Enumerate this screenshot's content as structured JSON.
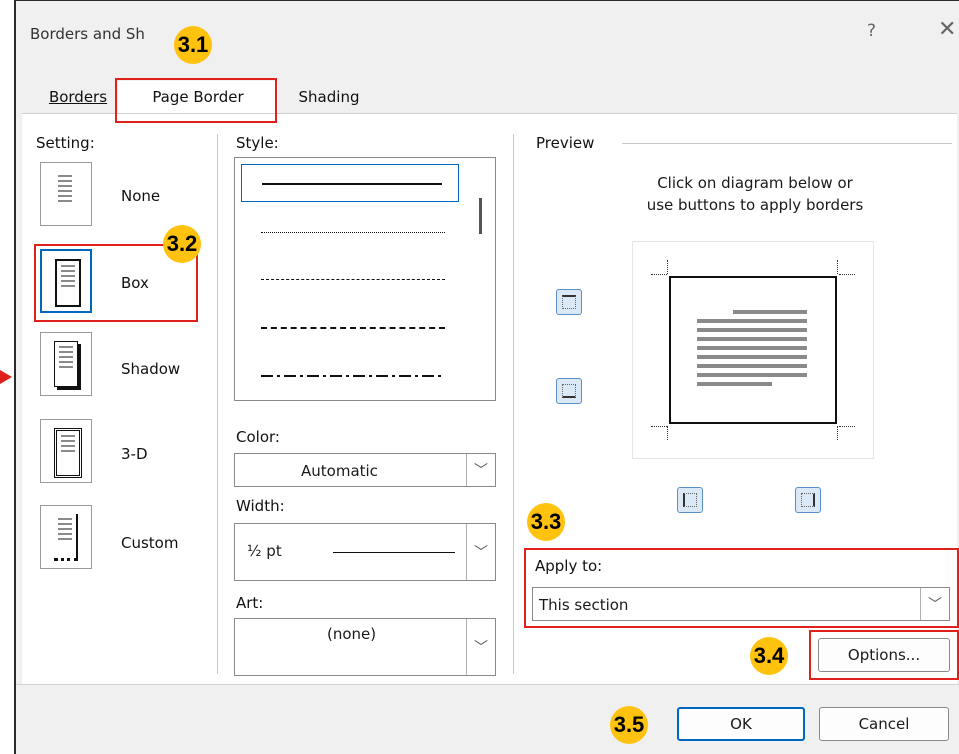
{
  "window": {
    "title": "Borders and Sh",
    "help": "?",
    "close": "✕"
  },
  "tabs": [
    {
      "label": "Borders",
      "underline_letter": "B"
    },
    {
      "label": "Page Border",
      "underline_letter": "P"
    },
    {
      "label": "Shading",
      "underline_letter": "S"
    }
  ],
  "setting": {
    "label": "Setting:",
    "options": [
      "None",
      "Box",
      "Shadow",
      "3-D",
      "Custom"
    ],
    "selected": "Box"
  },
  "style": {
    "label": "Style:"
  },
  "color": {
    "label": "Color:",
    "value": "Automatic"
  },
  "width": {
    "label": "Width:",
    "value": "½ pt"
  },
  "art": {
    "label": "Art:",
    "value": "(none)"
  },
  "preview": {
    "label": "Preview",
    "hint_line1": "Click on diagram below or",
    "hint_line2": "use buttons to apply borders"
  },
  "apply_to": {
    "label": "Apply to:",
    "value": "This section"
  },
  "buttons": {
    "options": "Options...",
    "ok": "OK",
    "cancel": "Cancel"
  },
  "annotations": [
    "3.1",
    "3.2",
    "3.3",
    "3.4",
    "3.5"
  ],
  "colors": {
    "accent": "#0067c0",
    "highlight_box": "#e0201b",
    "badge": "#ffc20e"
  }
}
